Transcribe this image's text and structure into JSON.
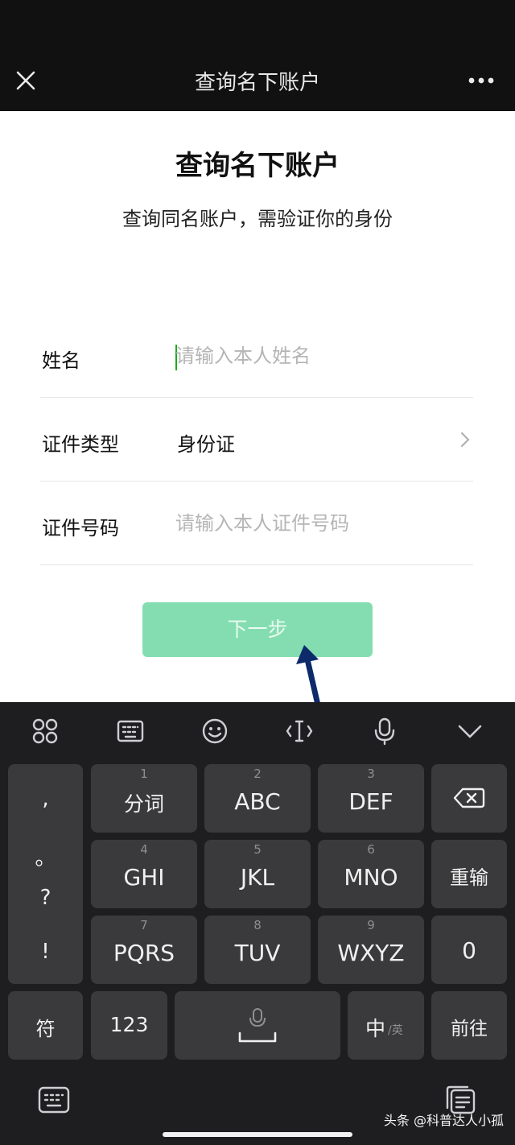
{
  "nav": {
    "title": "查询名下账户"
  },
  "page": {
    "title": "查询名下账户",
    "subtitle": "查询同名账户，需验证你的身份"
  },
  "form": {
    "name_label": "姓名",
    "name_placeholder": "请输入本人姓名",
    "idtype_label": "证件类型",
    "idtype_value": "身份证",
    "idnum_label": "证件号码",
    "idnum_placeholder": "请输入本人证件号码"
  },
  "next_button": {
    "label": "下一步"
  },
  "keyboard": {
    "punct": [
      ",",
      "。",
      "?",
      "!"
    ],
    "keys": {
      "k1": {
        "num": "1",
        "label": "分词"
      },
      "k2": {
        "num": "2",
        "label": "ABC"
      },
      "k3": {
        "num": "3",
        "label": "DEF"
      },
      "k4": {
        "num": "4",
        "label": "GHI"
      },
      "k5": {
        "num": "5",
        "label": "JKL"
      },
      "k6": {
        "num": "6",
        "label": "MNO"
      },
      "k7": {
        "num": "7",
        "label": "PQRS"
      },
      "k8": {
        "num": "8",
        "label": "TUV"
      },
      "k9": {
        "num": "9",
        "label": "WXYZ"
      }
    },
    "reenter": "重输",
    "zero": "0",
    "symbols": "符",
    "numbers": "123",
    "lang_main": "中",
    "lang_alt": "/英",
    "go": "前往"
  },
  "watermark": "头条 @科普达人小孤",
  "colors": {
    "accent": "#1aad19",
    "button_disabled": "#84ddb0",
    "arrow": "#0d2a6b"
  }
}
